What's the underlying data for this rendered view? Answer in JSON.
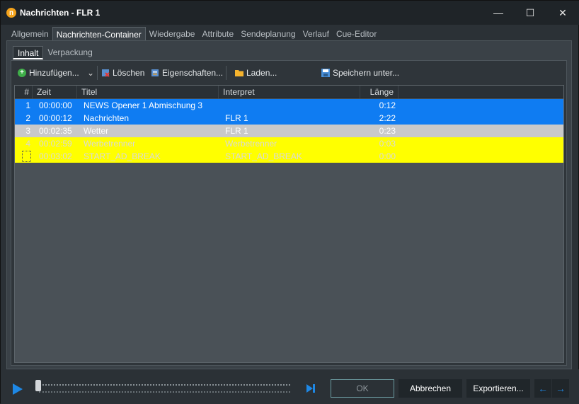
{
  "window": {
    "title": "Nachrichten - FLR 1",
    "app_icon": "n"
  },
  "window_controls": {
    "minimize": "—",
    "maximize": "☐",
    "close": "✕"
  },
  "main_tabs": [
    {
      "label": "Allgemein"
    },
    {
      "label": "Nachrichten-Container"
    },
    {
      "label": "Wiedergabe"
    },
    {
      "label": "Attribute"
    },
    {
      "label": "Sendeplanung"
    },
    {
      "label": "Verlauf"
    },
    {
      "label": "Cue-Editor"
    }
  ],
  "sub_tabs": [
    {
      "label": "Inhalt"
    },
    {
      "label": "Verpackung"
    }
  ],
  "toolbar": {
    "add": "Hinzufügen...",
    "delete": "Löschen",
    "properties": "Eigenschaften...",
    "load": "Laden...",
    "save_as": "Speichern unter..."
  },
  "table": {
    "headers": {
      "num": "#",
      "time": "Zeit",
      "title": "Titel",
      "artist": "Interpret",
      "length": "Länge"
    },
    "rows": [
      {
        "num": "1",
        "time": "00:00:00",
        "title": "NEWS Opener 1 Abmischung 3",
        "artist": "",
        "length": "0:12",
        "style": "blue"
      },
      {
        "num": "2",
        "time": "00:00:12",
        "title": "Nachrichten",
        "artist": "FLR 1",
        "length": "2:22",
        "style": "blue"
      },
      {
        "num": "3",
        "time": "00:02:35",
        "title": "Wetter",
        "artist": "FLR 1",
        "length": "0:23",
        "style": "grey"
      },
      {
        "num": "4",
        "time": "00:02:59",
        "title": "Werbetrenner",
        "artist": "Werbetrenner",
        "length": "0:03",
        "style": "yellow"
      },
      {
        "num": "",
        "time": "00:03:02",
        "title": "START_AD_BREAK",
        "artist": "START_AD_BREAK",
        "length": "0:00",
        "style": "yellow"
      }
    ]
  },
  "footer": {
    "ok": "OK",
    "cancel": "Abbrechen",
    "export": "Exportieren...",
    "prev": "←",
    "next": "→"
  },
  "colors": {
    "blue_row": "#0f7cf2",
    "grey_row": "#c9c9c9",
    "yellow_row": "#ffff00",
    "accent": "#1e88e5"
  },
  "player": {
    "position": 0
  }
}
